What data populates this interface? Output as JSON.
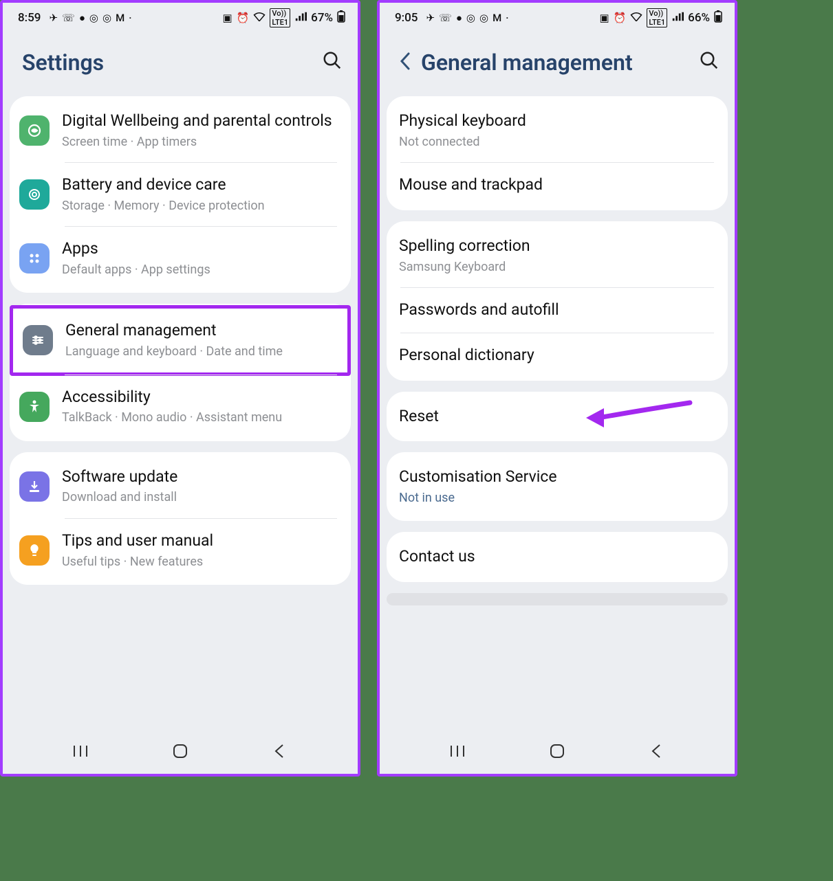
{
  "left": {
    "status": {
      "time": "8:59",
      "battery": "67%"
    },
    "header": {
      "title": "Settings"
    },
    "groups": [
      {
        "rows": [
          {
            "icon": "wellbeing",
            "label": "Digital Wellbeing and parental controls",
            "sub": "Screen time  ·  App timers"
          },
          {
            "icon": "devicecare",
            "label": "Battery and device care",
            "sub": "Storage  ·  Memory  ·  Device protection"
          },
          {
            "icon": "apps",
            "label": "Apps",
            "sub": "Default apps  ·  App settings"
          }
        ]
      },
      {
        "rows": [
          {
            "icon": "general",
            "label": "General management",
            "sub": "Language and keyboard  ·  Date and time",
            "highlight": true
          },
          {
            "icon": "accessibility",
            "label": "Accessibility",
            "sub": "TalkBack  ·  Mono audio  ·  Assistant menu"
          }
        ]
      },
      {
        "rows": [
          {
            "icon": "update",
            "label": "Software update",
            "sub": "Download and install"
          },
          {
            "icon": "tips",
            "label": "Tips and user manual",
            "sub": "Useful tips  ·  New features"
          }
        ]
      }
    ]
  },
  "right": {
    "status": {
      "time": "9:05",
      "battery": "66%"
    },
    "header": {
      "title": "General management"
    },
    "groups": [
      {
        "rows": [
          {
            "label": "Physical keyboard",
            "sub": "Not connected"
          },
          {
            "label": "Mouse and trackpad"
          }
        ]
      },
      {
        "rows": [
          {
            "label": "Spelling correction",
            "sub": "Samsung Keyboard"
          },
          {
            "label": "Passwords and autofill"
          },
          {
            "label": "Personal dictionary"
          }
        ]
      },
      {
        "rows": [
          {
            "label": "Reset",
            "arrow": true
          }
        ]
      },
      {
        "rows": [
          {
            "label": "Customisation Service",
            "sub": "Not in use",
            "subBlue": true
          }
        ]
      },
      {
        "rows": [
          {
            "label": "Contact us"
          }
        ]
      }
    ]
  }
}
